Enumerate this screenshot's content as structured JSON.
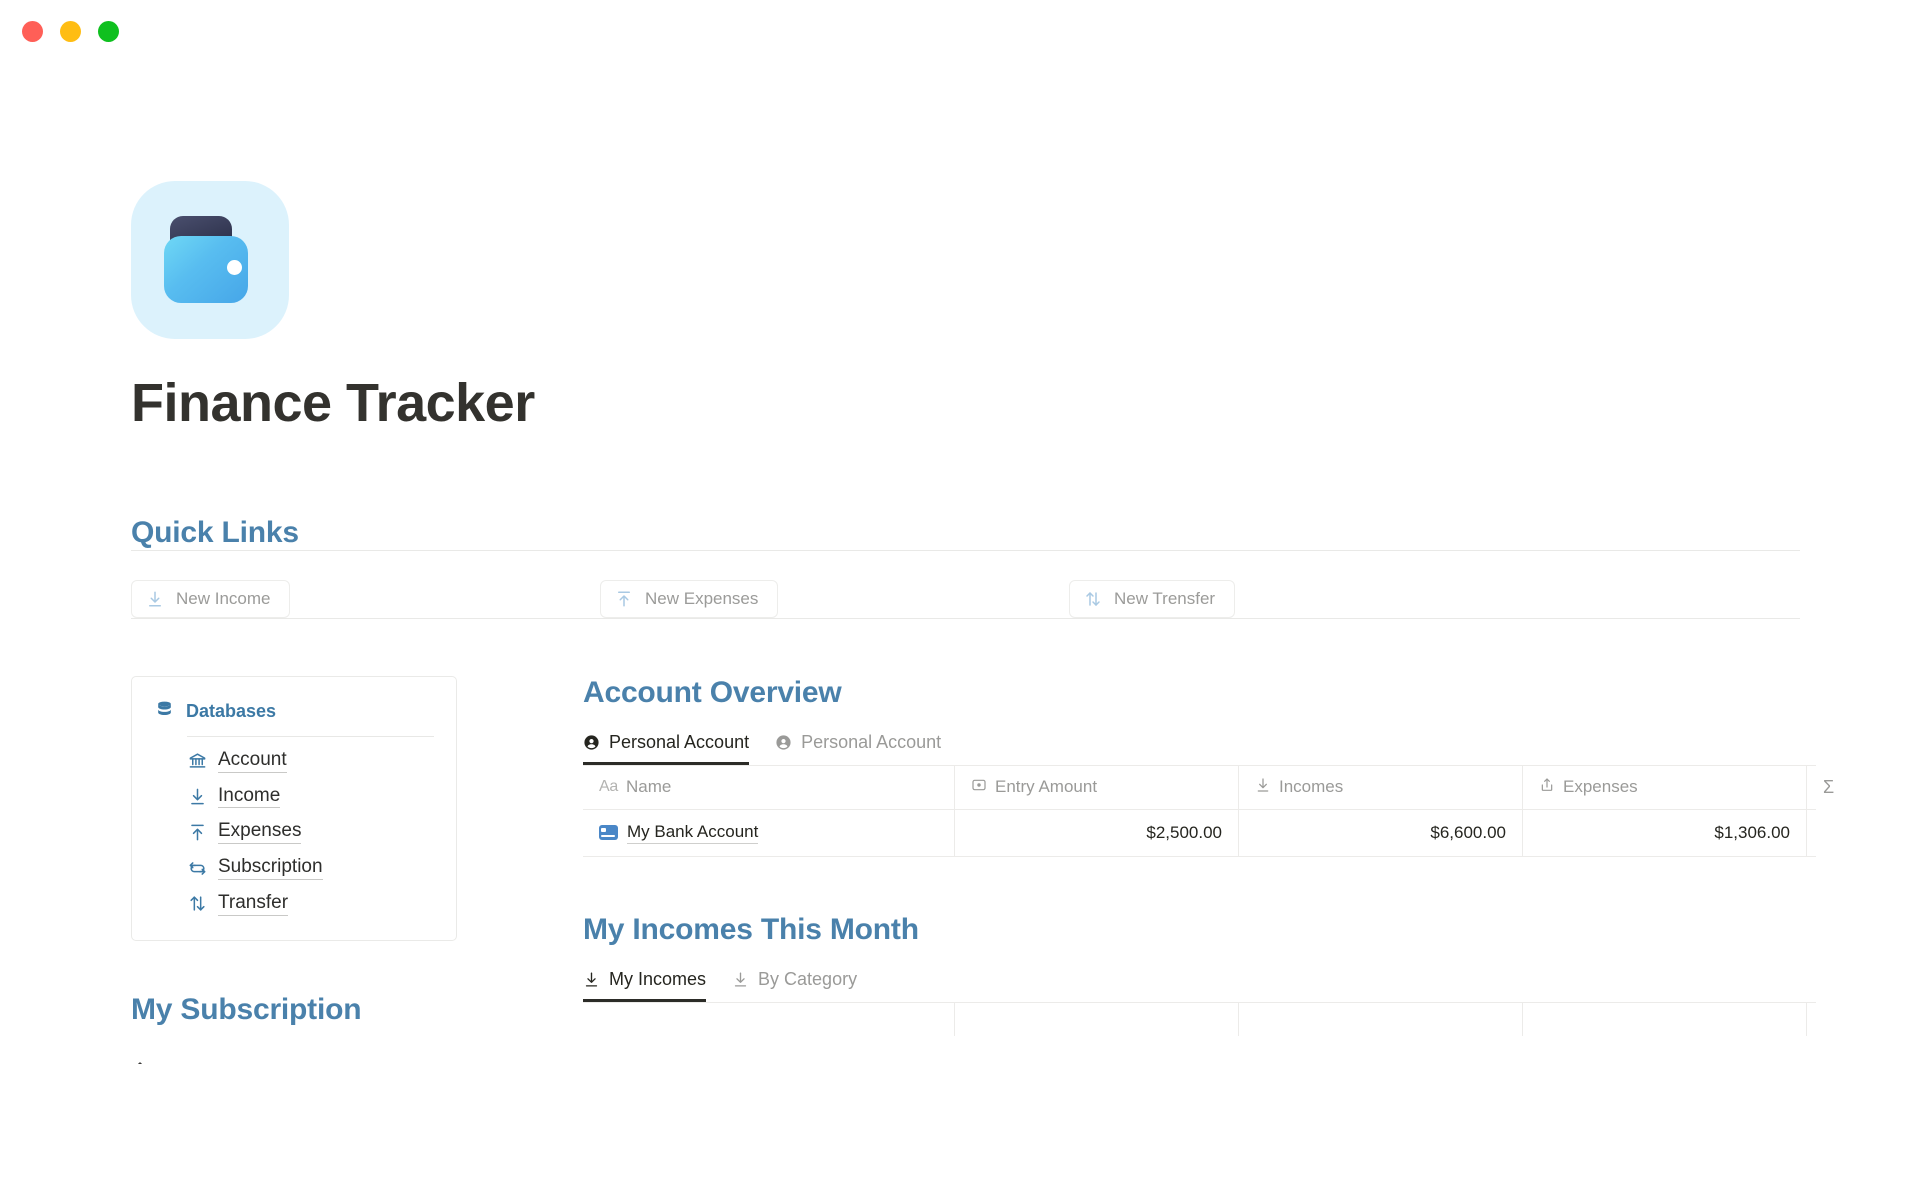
{
  "window": {
    "traffic_lights": [
      {
        "name": "close",
        "color": "#ff5f57"
      },
      {
        "name": "minimize",
        "color": "#ffbd13"
      },
      {
        "name": "maximize",
        "color": "#0fc01f"
      }
    ]
  },
  "hero": {
    "icon": "wallet-icon",
    "title": "Finance Tracker"
  },
  "quick_links": {
    "heading": "Quick Links",
    "buttons": [
      {
        "label": "New Income",
        "icon": "arrow-down-to-line-icon"
      },
      {
        "label": "New Expenses",
        "icon": "arrow-up-from-line-icon"
      },
      {
        "label": "New Trensfer",
        "icon": "arrows-up-down-icon"
      }
    ]
  },
  "databases": {
    "heading": "Databases",
    "icon": "database-icon",
    "items": [
      {
        "label": "Account",
        "icon": "bank-icon"
      },
      {
        "label": "Income",
        "icon": "arrow-down-to-line-icon"
      },
      {
        "label": "Expenses",
        "icon": "arrow-up-from-line-icon"
      },
      {
        "label": "Subscription",
        "icon": "refresh-loop-icon"
      },
      {
        "label": "Transfer",
        "icon": "arrows-up-down-icon"
      }
    ]
  },
  "subscription": {
    "heading": "My Subscription"
  },
  "account_overview": {
    "heading": "Account Overview",
    "tabs": [
      {
        "label": "Personal Account",
        "icon": "person-circle-icon",
        "active": true
      },
      {
        "label": "Personal Account",
        "icon": "person-circle-icon",
        "active": false
      }
    ],
    "columns": [
      {
        "label": "Name",
        "icon": "aa-text-icon"
      },
      {
        "label": "Entry Amount",
        "icon": "money-box-icon"
      },
      {
        "label": "Incomes",
        "icon": "arrow-down-to-line-icon"
      },
      {
        "label": "Expenses",
        "icon": "upload-tray-icon"
      },
      {
        "label": "",
        "icon": "sigma-icon"
      }
    ],
    "rows": [
      {
        "icon": "credit-card-icon",
        "name": "My Bank Account",
        "entry_amount": "$2,500.00",
        "incomes": "$6,600.00",
        "expenses": "$1,306.00",
        "sum": ""
      }
    ]
  },
  "my_incomes": {
    "heading": "My Incomes This Month",
    "tabs": [
      {
        "label": "My Incomes",
        "icon": "arrow-down-to-line-icon",
        "active": true
      },
      {
        "label": "By Category",
        "icon": "arrow-down-to-line-icon",
        "active": false
      }
    ]
  },
  "colors": {
    "accent_blue": "#4a81ab",
    "link_blue": "#3c79a5",
    "icon_blue_light": "#a9c9e3",
    "text_dark": "#33322e",
    "text_muted": "#9a9a98",
    "border": "#ecebe9"
  }
}
